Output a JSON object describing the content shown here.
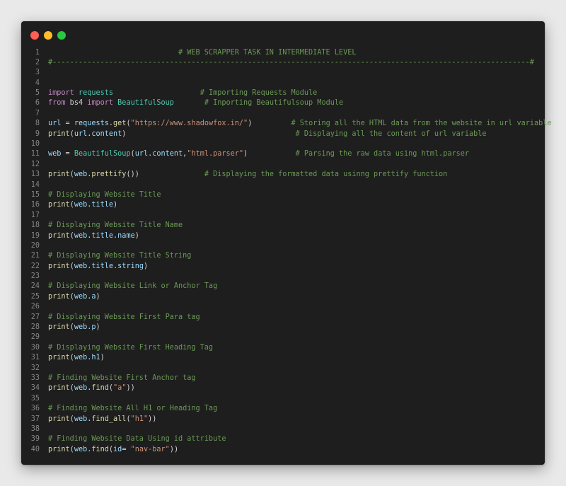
{
  "window": {
    "controls": [
      "close",
      "minimize",
      "maximize"
    ],
    "colors": {
      "close": "#ff5f56",
      "minimize": "#ffbd2e",
      "maximize": "#27c93f"
    }
  },
  "code": {
    "lines": [
      [
        {
          "t": "                              # WEB SCRAPPER TASK IN INTERMEDIATE LEVEL",
          "c": "cm"
        }
      ],
      [
        {
          "t": "#--------------------------------------------------------------------------------------------------------------#",
          "c": "cm"
        }
      ],
      [],
      [],
      [
        {
          "t": "import",
          "c": "kw"
        },
        {
          "t": " ",
          "c": "p"
        },
        {
          "t": "requests",
          "c": "mod"
        },
        {
          "t": "                    ",
          "c": "p"
        },
        {
          "t": "# Importing Requests Module",
          "c": "cm"
        }
      ],
      [
        {
          "t": "from",
          "c": "kw"
        },
        {
          "t": " bs4 ",
          "c": "p"
        },
        {
          "t": "import",
          "c": "kw"
        },
        {
          "t": " ",
          "c": "p"
        },
        {
          "t": "BeautifulSoup",
          "c": "mod"
        },
        {
          "t": "       ",
          "c": "p"
        },
        {
          "t": "# Inporting Beautifulsoup Module",
          "c": "cm"
        }
      ],
      [],
      [
        {
          "t": "url",
          "c": "var"
        },
        {
          "t": " = ",
          "c": "p"
        },
        {
          "t": "requests",
          "c": "var"
        },
        {
          "t": ".",
          "c": "p"
        },
        {
          "t": "get",
          "c": "fn"
        },
        {
          "t": "(",
          "c": "p"
        },
        {
          "t": "\"https://www.shadowfox.in/\"",
          "c": "str"
        },
        {
          "t": ")         ",
          "c": "p"
        },
        {
          "t": "# Storing all the HTML data from the website in url variable",
          "c": "cm"
        }
      ],
      [
        {
          "t": "print",
          "c": "fn"
        },
        {
          "t": "(",
          "c": "p"
        },
        {
          "t": "url",
          "c": "var"
        },
        {
          "t": ".",
          "c": "p"
        },
        {
          "t": "content",
          "c": "var"
        },
        {
          "t": ")                                       ",
          "c": "p"
        },
        {
          "t": "# Displaying all the content of url variable",
          "c": "cm"
        }
      ],
      [],
      [
        {
          "t": "web",
          "c": "var"
        },
        {
          "t": " = ",
          "c": "p"
        },
        {
          "t": "BeautifulSoup",
          "c": "mod"
        },
        {
          "t": "(",
          "c": "p"
        },
        {
          "t": "url",
          "c": "var"
        },
        {
          "t": ".",
          "c": "p"
        },
        {
          "t": "content",
          "c": "var"
        },
        {
          "t": ",",
          "c": "p"
        },
        {
          "t": "\"html.parser\"",
          "c": "str"
        },
        {
          "t": ")           ",
          "c": "p"
        },
        {
          "t": "# Parsing the raw data using html.parser",
          "c": "cm"
        }
      ],
      [],
      [
        {
          "t": "print",
          "c": "fn"
        },
        {
          "t": "(",
          "c": "p"
        },
        {
          "t": "web",
          "c": "var"
        },
        {
          "t": ".",
          "c": "p"
        },
        {
          "t": "prettify",
          "c": "fn"
        },
        {
          "t": "())               ",
          "c": "p"
        },
        {
          "t": "# Displaying the formatted data usinng prettify function",
          "c": "cm"
        }
      ],
      [],
      [
        {
          "t": "# Displaying Website Title",
          "c": "cm"
        }
      ],
      [
        {
          "t": "print",
          "c": "fn"
        },
        {
          "t": "(",
          "c": "p"
        },
        {
          "t": "web",
          "c": "var"
        },
        {
          "t": ".",
          "c": "p"
        },
        {
          "t": "title",
          "c": "var"
        },
        {
          "t": ")",
          "c": "p"
        }
      ],
      [],
      [
        {
          "t": "# Displaying Website Title Name",
          "c": "cm"
        }
      ],
      [
        {
          "t": "print",
          "c": "fn"
        },
        {
          "t": "(",
          "c": "p"
        },
        {
          "t": "web",
          "c": "var"
        },
        {
          "t": ".",
          "c": "p"
        },
        {
          "t": "title",
          "c": "var"
        },
        {
          "t": ".",
          "c": "p"
        },
        {
          "t": "name",
          "c": "var"
        },
        {
          "t": ")",
          "c": "p"
        }
      ],
      [],
      [
        {
          "t": "# Displaying Website Title String",
          "c": "cm"
        }
      ],
      [
        {
          "t": "print",
          "c": "fn"
        },
        {
          "t": "(",
          "c": "p"
        },
        {
          "t": "web",
          "c": "var"
        },
        {
          "t": ".",
          "c": "p"
        },
        {
          "t": "title",
          "c": "var"
        },
        {
          "t": ".",
          "c": "p"
        },
        {
          "t": "string",
          "c": "var"
        },
        {
          "t": ")",
          "c": "p"
        }
      ],
      [],
      [
        {
          "t": "# Displaying Website Link or Anchor Tag",
          "c": "cm"
        }
      ],
      [
        {
          "t": "print",
          "c": "fn"
        },
        {
          "t": "(",
          "c": "p"
        },
        {
          "t": "web",
          "c": "var"
        },
        {
          "t": ".",
          "c": "p"
        },
        {
          "t": "a",
          "c": "var"
        },
        {
          "t": ")",
          "c": "p"
        }
      ],
      [],
      [
        {
          "t": "# Displaying Website First Para tag",
          "c": "cm"
        }
      ],
      [
        {
          "t": "print",
          "c": "fn"
        },
        {
          "t": "(",
          "c": "p"
        },
        {
          "t": "web",
          "c": "var"
        },
        {
          "t": ".",
          "c": "p"
        },
        {
          "t": "p",
          "c": "var"
        },
        {
          "t": ")",
          "c": "p"
        }
      ],
      [],
      [
        {
          "t": "# Displaying Website First Heading Tag",
          "c": "cm"
        }
      ],
      [
        {
          "t": "print",
          "c": "fn"
        },
        {
          "t": "(",
          "c": "p"
        },
        {
          "t": "web",
          "c": "var"
        },
        {
          "t": ".",
          "c": "p"
        },
        {
          "t": "h1",
          "c": "var"
        },
        {
          "t": ")",
          "c": "p"
        }
      ],
      [],
      [
        {
          "t": "# Finding Website First Anchor tag",
          "c": "cm"
        }
      ],
      [
        {
          "t": "print",
          "c": "fn"
        },
        {
          "t": "(",
          "c": "p"
        },
        {
          "t": "web",
          "c": "var"
        },
        {
          "t": ".",
          "c": "p"
        },
        {
          "t": "find",
          "c": "fn"
        },
        {
          "t": "(",
          "c": "p"
        },
        {
          "t": "\"a\"",
          "c": "str"
        },
        {
          "t": "))",
          "c": "p"
        }
      ],
      [],
      [
        {
          "t": "# Finding Website All H1 or Heading Tag",
          "c": "cm"
        }
      ],
      [
        {
          "t": "print",
          "c": "fn"
        },
        {
          "t": "(",
          "c": "p"
        },
        {
          "t": "web",
          "c": "var"
        },
        {
          "t": ".",
          "c": "p"
        },
        {
          "t": "find_all",
          "c": "fn"
        },
        {
          "t": "(",
          "c": "p"
        },
        {
          "t": "\"h1\"",
          "c": "str"
        },
        {
          "t": "))",
          "c": "p"
        }
      ],
      [],
      [
        {
          "t": "# Finding Website Data Using id attribute",
          "c": "cm"
        }
      ],
      [
        {
          "t": "print",
          "c": "fn"
        },
        {
          "t": "(",
          "c": "p"
        },
        {
          "t": "web",
          "c": "var"
        },
        {
          "t": ".",
          "c": "p"
        },
        {
          "t": "find",
          "c": "fn"
        },
        {
          "t": "(",
          "c": "p"
        },
        {
          "t": "id",
          "c": "var"
        },
        {
          "t": "= ",
          "c": "p"
        },
        {
          "t": "\"nav-bar\"",
          "c": "str"
        },
        {
          "t": "))",
          "c": "p"
        }
      ]
    ]
  }
}
